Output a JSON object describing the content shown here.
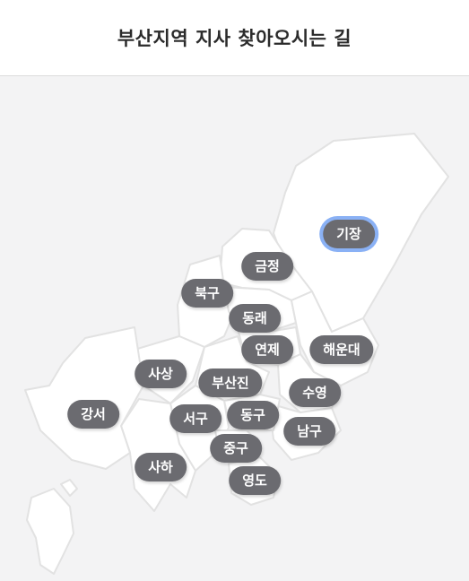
{
  "header": {
    "title": "부산지역 지사 찾아오시는 길"
  },
  "map": {
    "selected": "기장",
    "districts": {
      "gijang": "기장",
      "geumjeong": "금정",
      "buk": "북구",
      "dongrae": "동래",
      "yeonje": "연제",
      "haeundae": "해운대",
      "sasang": "사상",
      "busanjin": "부산진",
      "suyeong": "수영",
      "gangseo": "강서",
      "seo": "서구",
      "dong": "동구",
      "nam": "남구",
      "jung": "중구",
      "saha": "사하",
      "yeongdo": "영도"
    }
  },
  "colors": {
    "pill_bg": "#6b6b70",
    "selected_ring": "#8ab1f5",
    "map_bg": "#f3f3f4",
    "land": "#ffffff"
  }
}
